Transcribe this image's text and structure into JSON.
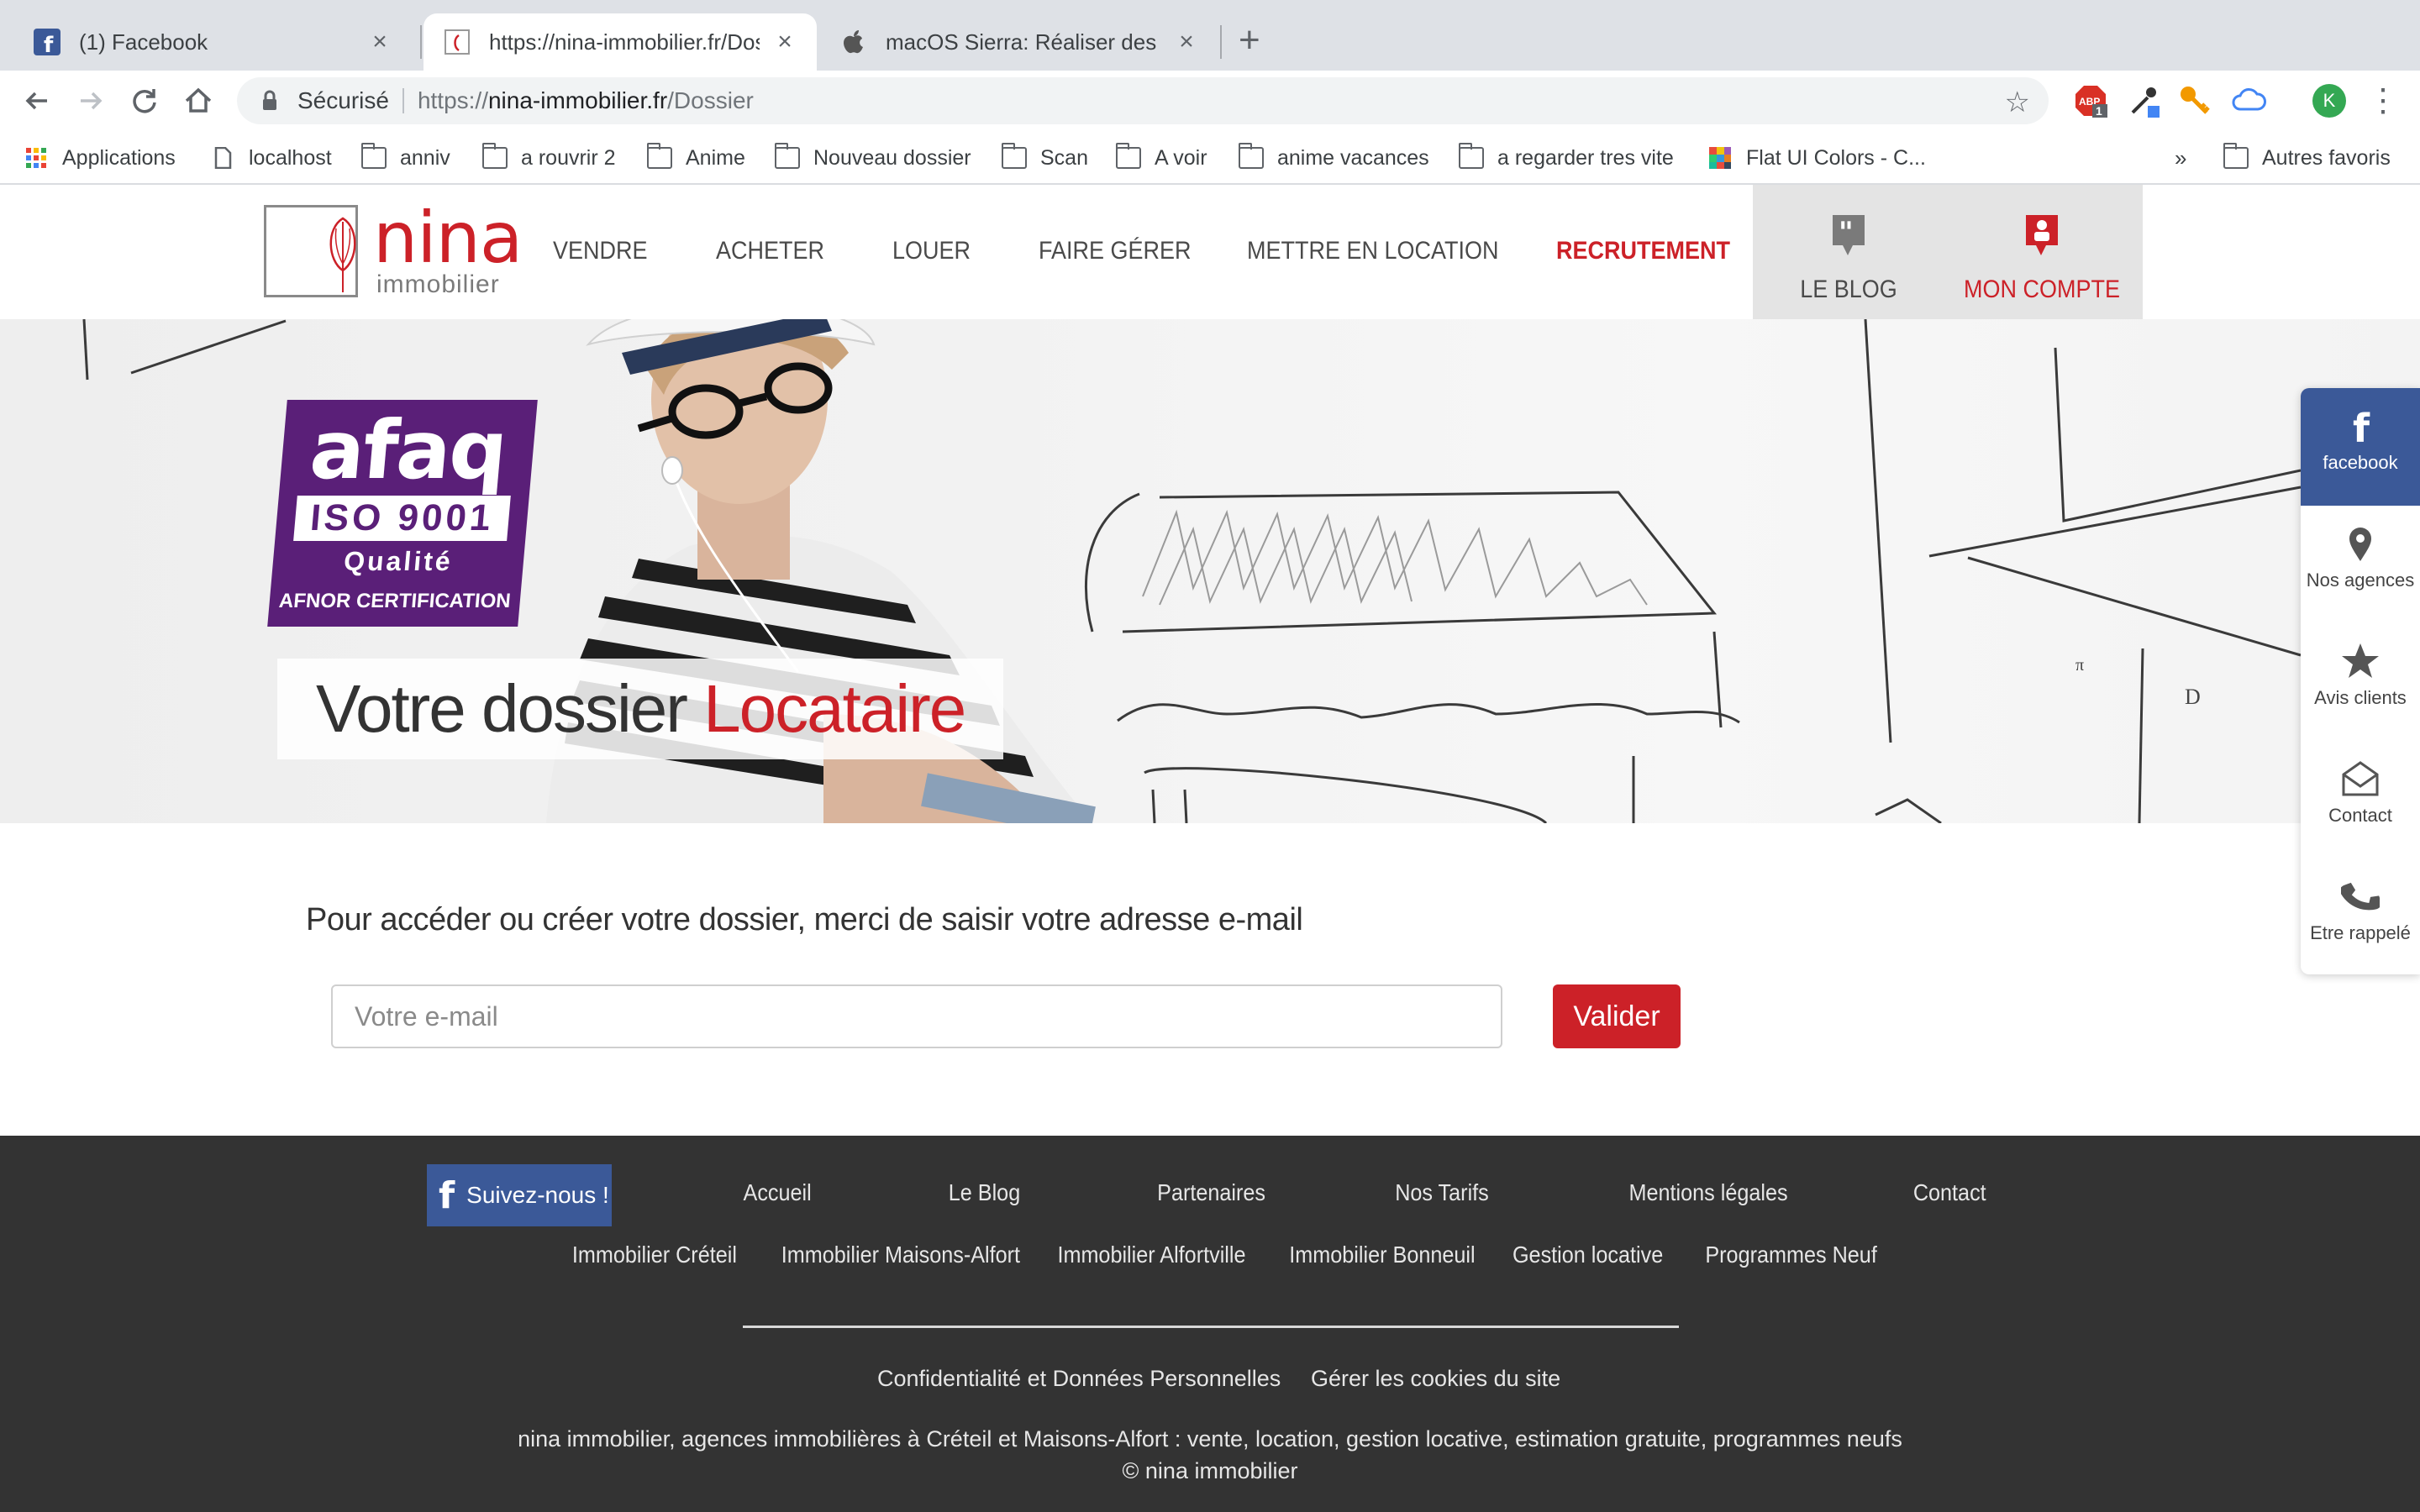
{
  "browser": {
    "tabs": [
      {
        "title": "(1) Facebook",
        "icon": "facebook-icon"
      },
      {
        "title": "https://nina-immobilier.fr/Dossier",
        "icon": "nina-icon"
      },
      {
        "title": "macOS Sierra: Réaliser des captures",
        "icon": "apple-icon"
      }
    ],
    "address": {
      "secure_label": "Sécurisé",
      "url_scheme": "https://",
      "url_host": "nina-immobilier.fr",
      "url_path": "/Dossier"
    },
    "extensions": {
      "abp_badge": "1",
      "avatar_letter": "K"
    },
    "bookmarks": [
      {
        "label": "Applications",
        "icon": "apps-grid-icon"
      },
      {
        "label": "localhost",
        "icon": "page-icon"
      },
      {
        "label": "anniv",
        "icon": "folder-icon"
      },
      {
        "label": "a rouvrir 2",
        "icon": "folder-icon"
      },
      {
        "label": "Anime",
        "icon": "folder-icon"
      },
      {
        "label": "Nouveau dossier",
        "icon": "folder-icon"
      },
      {
        "label": "Scan",
        "icon": "folder-icon"
      },
      {
        "label": "A voir",
        "icon": "folder-icon"
      },
      {
        "label": "anime vacances",
        "icon": "folder-icon"
      },
      {
        "label": "a regarder tres vite",
        "icon": "folder-icon"
      },
      {
        "label": "Flat UI Colors - C...",
        "icon": "flat-ui-icon"
      }
    ],
    "overflow": "»",
    "other_bookmarks": "Autres favoris"
  },
  "site": {
    "logo": {
      "name": "nina",
      "sub": "immobilier"
    },
    "menu": [
      "VENDRE",
      "ACHETER",
      "LOUER",
      "FAIRE GÉRER",
      "METTRE EN LOCATION",
      "RECRUTEMENT"
    ],
    "blog_label": "LE BLOG",
    "account_label": "MON COMPTE"
  },
  "hero": {
    "badge": {
      "line1": "afaq",
      "line2": "ISO 9001",
      "line3": "Qualité",
      "line4": "AFNOR CERTIFICATION"
    },
    "title_prefix": "Votre dossier ",
    "title_highlight": "Locataire"
  },
  "form": {
    "prompt": "Pour accéder ou créer votre dossier, merci de saisir votre adresse e-mail",
    "email_placeholder": "Votre e-mail",
    "submit_label": "Valider"
  },
  "side_panel": [
    {
      "label": "facebook",
      "icon": "facebook-icon"
    },
    {
      "label": "Nos agences",
      "icon": "map-pin-icon"
    },
    {
      "label": "Avis clients",
      "icon": "star-icon"
    },
    {
      "label": "Contact",
      "icon": "envelope-icon"
    },
    {
      "label": "Etre rappelé",
      "icon": "phone-icon"
    }
  ],
  "footer": {
    "follow_label": "Suivez-nous !",
    "row1": [
      "Accueil",
      "Le Blog",
      "Partenaires",
      "Nos Tarifs",
      "Mentions légales",
      "Contact"
    ],
    "row2": [
      "Immobilier Créteil",
      "Immobilier Maisons-Alfort",
      "Immobilier Alfortville",
      "Immobilier Bonneuil",
      "Gestion locative",
      "Programmes Neuf"
    ],
    "privacy": "Confidentialité et Données Personnelles",
    "cookies": "Gérer les cookies du site",
    "tagline": "nina immobilier, agences immobilières à Créteil et Maisons-Alfort : vente, location, gestion locative, estimation gratuite, programmes neufs",
    "copyright": "© nina immobilier"
  },
  "colors": {
    "brand_red": "#cc2128",
    "facebook_blue": "#3b5998",
    "footer_bg": "#333333",
    "afaq_purple": "#5a1f78"
  }
}
